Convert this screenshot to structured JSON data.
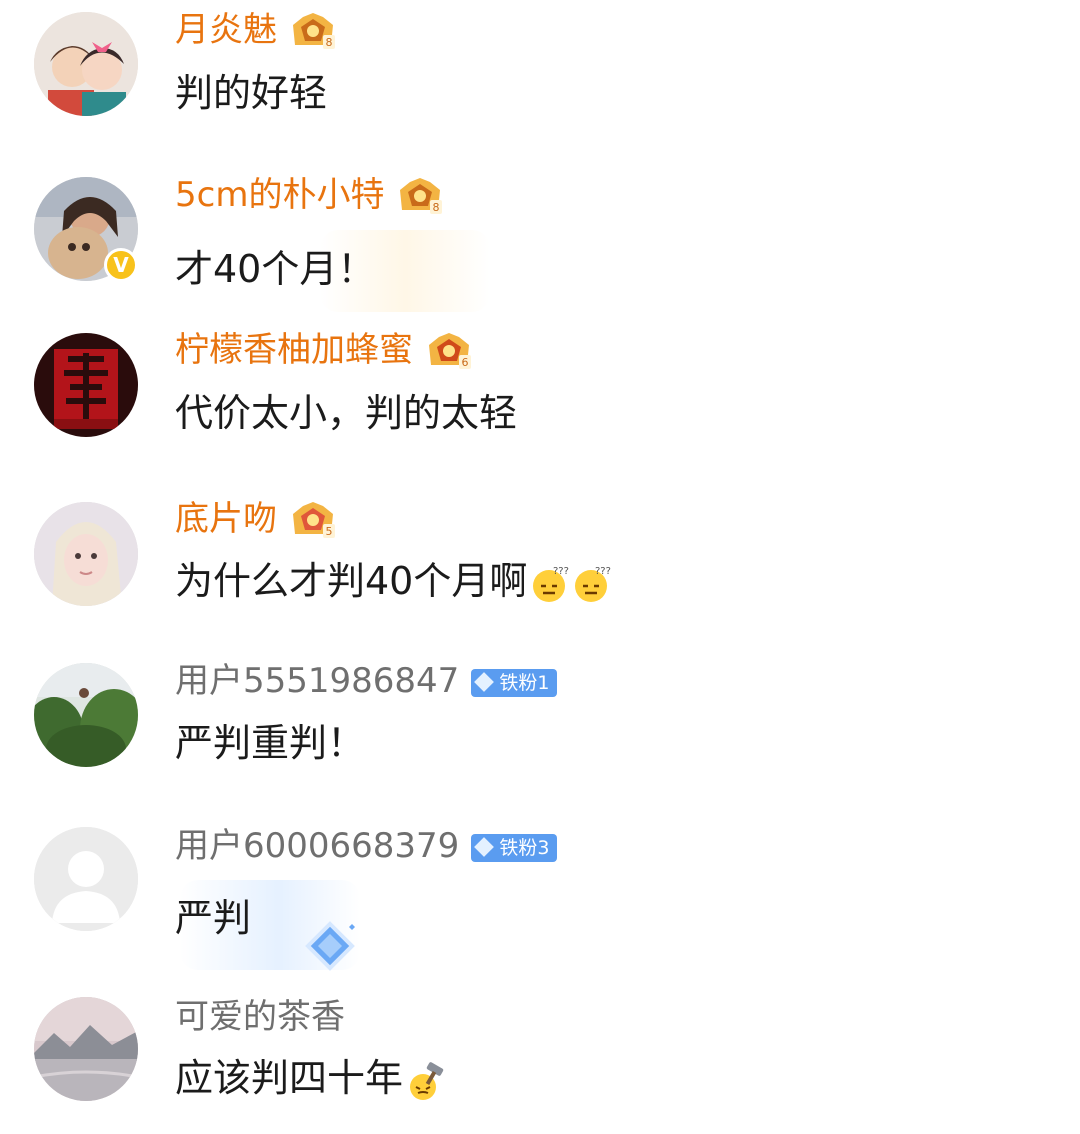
{
  "comments": [
    {
      "username": "月炎魅",
      "name_style": "vip",
      "badge": "crown-level-badge",
      "badge_level": "8",
      "text": "判的好轻",
      "avatar": "couple-cartoon-avatar"
    },
    {
      "username": "5cm的朴小特",
      "name_style": "vip",
      "badge": "crown-level-badge",
      "badge_level": "8",
      "text": "才40个月！",
      "avatar": "woman-with-dog-avatar",
      "verified": "V"
    },
    {
      "username": "柠檬香柚加蜂蜜",
      "name_style": "vip",
      "badge": "crown-level-badge",
      "badge_level": "6",
      "text": "代价太小，判的太轻",
      "avatar": "red-calligraphy-avatar"
    },
    {
      "username": "底片吻",
      "name_style": "vip",
      "badge": "crown-level-badge",
      "badge_level": "5",
      "text": "为什么才判40个月啊",
      "avatar": "blonde-girl-avatar",
      "emojis": [
        "confused-emoji",
        "confused-emoji"
      ]
    },
    {
      "username": "用户5551986847",
      "name_style": "plain",
      "badge": "iron-fan-badge",
      "badge_text": "铁粉1",
      "text": "严判重判！",
      "avatar": "garden-person-avatar"
    },
    {
      "username": "用户6000668379",
      "name_style": "plain",
      "badge": "iron-fan-badge",
      "badge_text": "铁粉3",
      "text": "严判",
      "avatar": "default-user-avatar"
    },
    {
      "username": "可爱的茶香",
      "name_style": "plain",
      "text": "应该判四十年",
      "avatar": "mountain-lake-avatar",
      "emojis": [
        "judge-gavel-emoji"
      ]
    }
  ],
  "colors": {
    "vip_name": "#e8740f",
    "plain_name": "#6f6f6f",
    "text": "#1b1b1b",
    "fan_badge": "#5a9cf0",
    "verified": "#f8c21b"
  }
}
